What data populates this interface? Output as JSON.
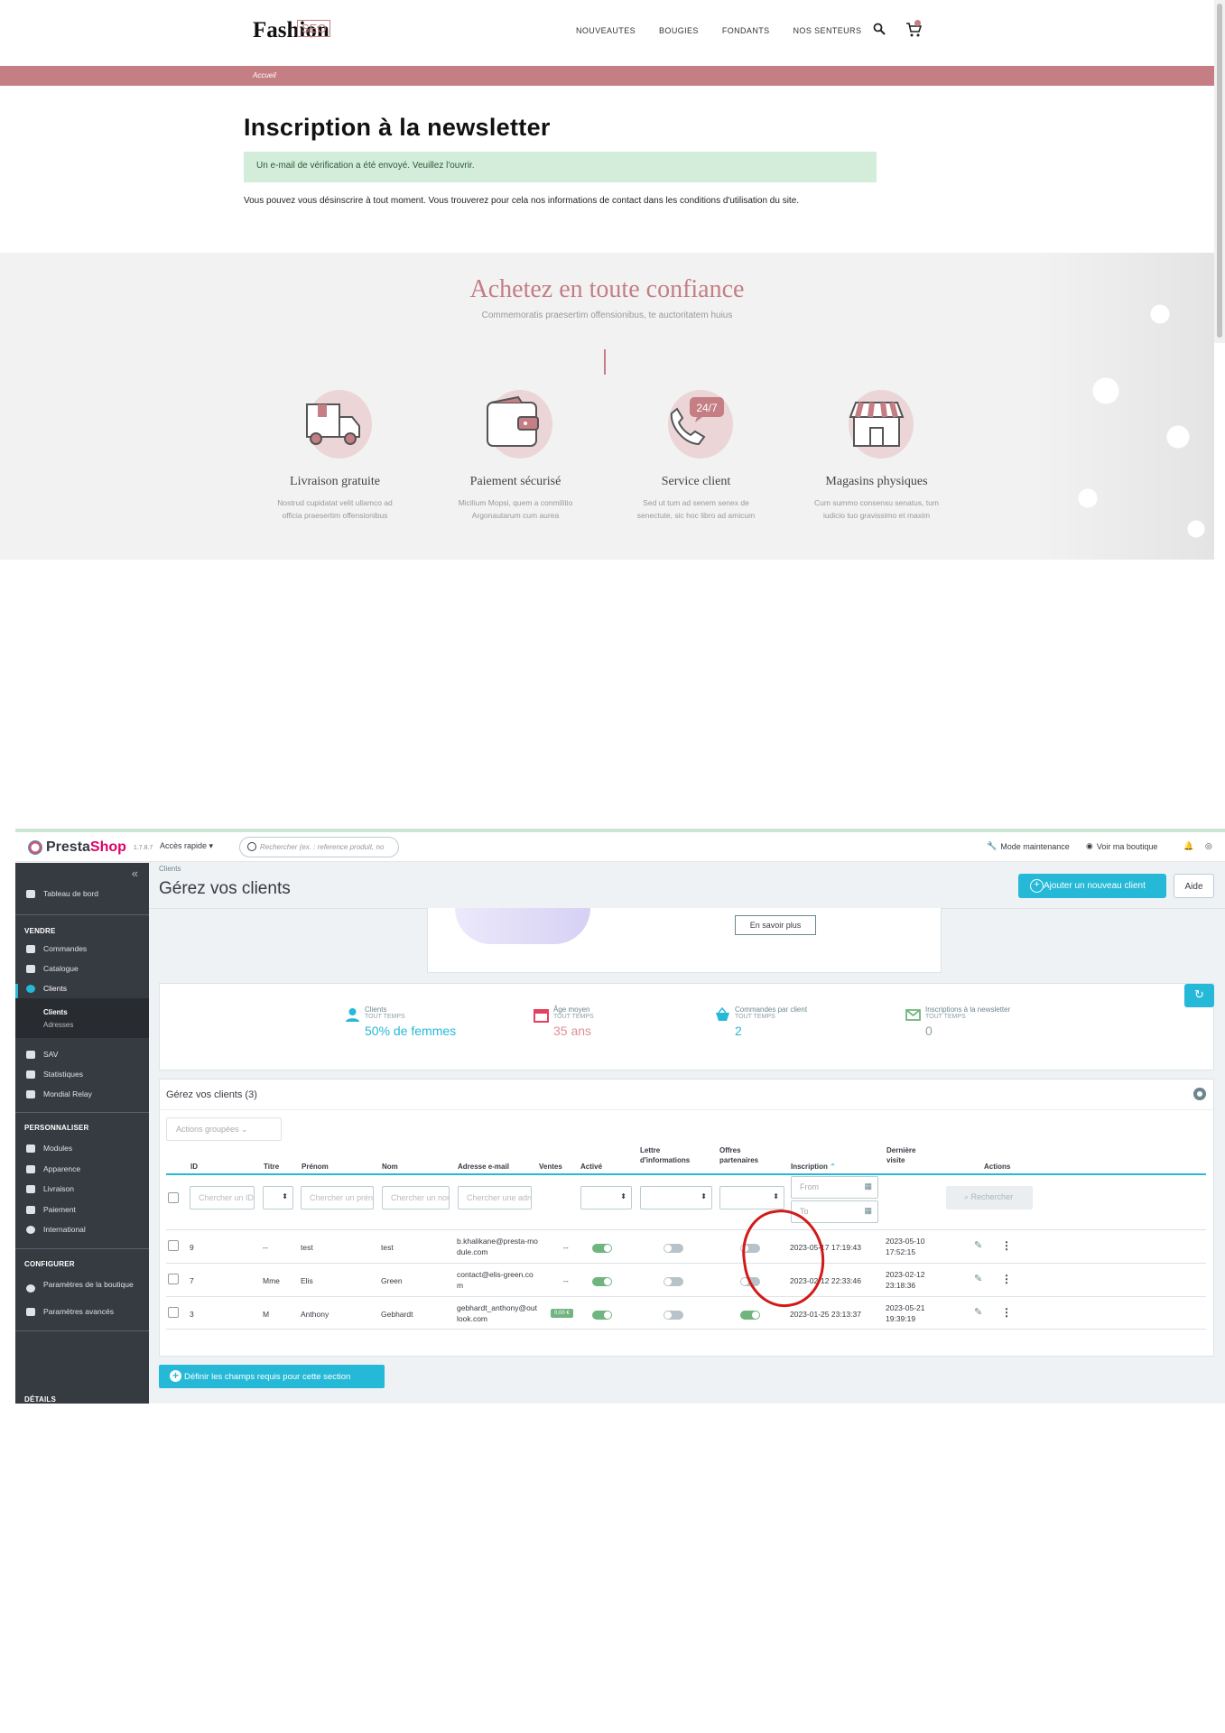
{
  "shop": {
    "logo": "Fashion",
    "logo_badge": "SEO",
    "nav": [
      "NOUVEAUTES",
      "BOUGIES",
      "FONDANTS",
      "NOS SENTEURS"
    ],
    "breadcrumb": "Accueil",
    "title": "Inscription à la newsletter",
    "alert": "Un e-mail de vérification a été envoyé. Veuillez l'ouvrir.",
    "info": "Vous pouvez vous désinscrire à tout moment. Vous trouverez pour cela nos informations de contact dans les conditions d'utilisation du site.",
    "trust_title": "Achetez en toute confiance",
    "trust_subtitle": "Commemoratis praesertim offensionibus, te auctoritatem huius",
    "features": [
      {
        "title": "Livraison gratuite",
        "desc": "Nostrud cupidatat velit ullamco ad officia praesertim offensionibus"
      },
      {
        "title": "Paiement sécurisé",
        "desc": "Micilium Mopsi, quem a conmilitio Argonautarum cum aurea"
      },
      {
        "title": "Service client",
        "desc": "Sed ut tum ad senem senex de senectute, sic hoc libro ad amicum",
        "badge": "24/7"
      },
      {
        "title": "Magasins physiques",
        "desc": "Cum summo consensu senatus, tum iudicio tuo gravissimo et maxim"
      }
    ],
    "accent": "#c47e84"
  },
  "admin": {
    "brand_a": "Presta",
    "brand_b": "Shop",
    "version": "1.7.8.7",
    "quick_access": "Accès rapide ▾",
    "search_placeholder": "Rechercher (ex. : reference produit, no",
    "maintenance": "Mode maintenance",
    "view_shop": "Voir ma boutique",
    "sidebar": {
      "dashboard": "Tableau de bord",
      "sections": [
        "VENDRE",
        "PERSONNALISER",
        "CONFIGURER",
        "DÉTAILS"
      ],
      "sell_items": [
        "Commandes",
        "Catalogue",
        "Clients"
      ],
      "client_sub": [
        "Clients",
        "Adresses"
      ],
      "sell_items2": [
        "SAV",
        "Statistiques",
        "Mondial Relay"
      ],
      "personalize_items": [
        "Modules",
        "Apparence",
        "Livraison",
        "Paiement",
        "International"
      ],
      "configure_items": [
        "Paramètres de la boutique",
        "Paramètres avancés"
      ]
    },
    "breadcrumb": "Clients",
    "title": "Gérez vos clients",
    "add_button": "Ajouter un nouveau client",
    "help_button": "Aide",
    "promo_button": "En savoir plus",
    "kpis": [
      {
        "label": "Clients",
        "period": "TOUT TEMPS",
        "value": "50% de femmes",
        "color": "#25b9d7"
      },
      {
        "label": "Âge moyen",
        "period": "TOUT TEMPS",
        "value": "35 ans",
        "color": "#e08f95"
      },
      {
        "label": "Commandes par client",
        "period": "TOUT TEMPS",
        "value": "2",
        "color": "#25b9d7"
      },
      {
        "label": "Inscriptions à la newsletter",
        "period": "TOUT TEMPS",
        "value": "0",
        "color": "#8fa1a7"
      }
    ],
    "panel_title": "Gérez vos clients (3)",
    "bulk_actions": "Actions groupées",
    "columns": [
      "ID",
      "Titre",
      "Prénom",
      "Nom",
      "Adresse e-mail",
      "Ventes",
      "Activé",
      "Lettre d'informations",
      "Offres partenaires",
      "Inscription",
      "Dernière visite",
      "Actions"
    ],
    "filters": {
      "id": "Chercher un ID",
      "firstname": "Chercher un prénom",
      "lastname": "Chercher un nom",
      "email": "Chercher une adresse",
      "date_from": "From",
      "date_to": "To",
      "search_button": "Rechercher"
    },
    "rows": [
      {
        "id": "9",
        "title": "--",
        "firstname": "test",
        "lastname": "test",
        "email": "b.khalikane@presta-module.com",
        "sales": "--",
        "active": true,
        "newsletter": false,
        "optin": false,
        "registered": "2023-05-17 17:19:43",
        "last_visit": "2023-05-10 17:52:15"
      },
      {
        "id": "7",
        "title": "Mme",
        "firstname": "Elis",
        "lastname": "Green",
        "email": "contact@elis-green.com",
        "sales": "--",
        "active": true,
        "newsletter": false,
        "optin": false,
        "registered": "2023-02-12 22:33:46",
        "last_visit": "2023-02-12 23:18:36"
      },
      {
        "id": "3",
        "title": "M",
        "firstname": "Anthony",
        "lastname": "Gebhardt",
        "email": "gebhardt_anthony@outlook.com",
        "sales": "0,00 €",
        "active": true,
        "newsletter": false,
        "optin": true,
        "registered": "2023-01-25 23:13:37",
        "last_visit": "2023-05-21 19:39:19"
      }
    ],
    "required_fields_button": "Définir les champs requis pour cette section",
    "accent": "#25b9d7"
  }
}
